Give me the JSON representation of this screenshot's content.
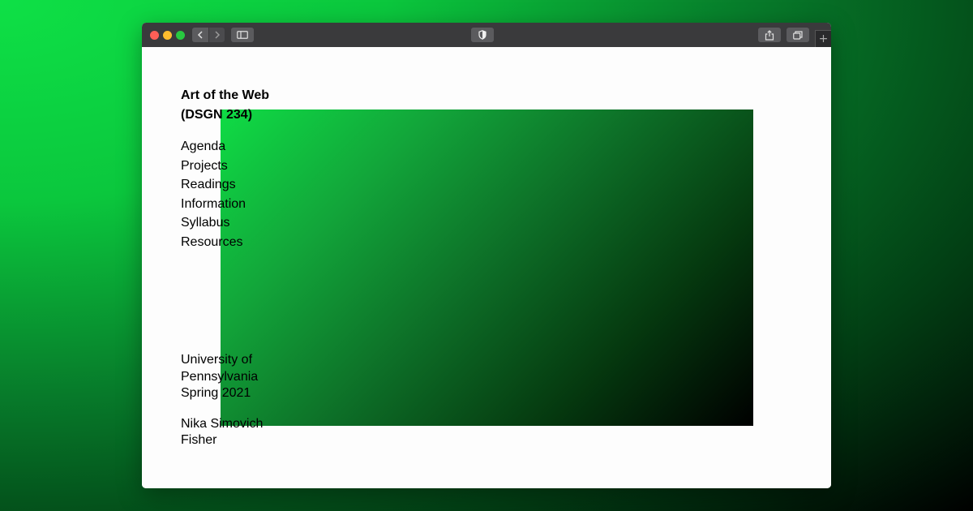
{
  "browser": {
    "buttons": {
      "back_icon": "chevron-left-icon",
      "forward_icon": "chevron-right-icon",
      "sidebar_icon": "sidebar-icon",
      "privacy_icon": "shield-icon",
      "share_icon": "share-icon",
      "tabs_icon": "tabs-overview-icon",
      "new_tab_label": "+"
    }
  },
  "page": {
    "title_line1": "Art of the Web",
    "title_line2": "(DSGN 234)",
    "nav": {
      "agenda": "Agenda",
      "projects": "Projects",
      "readings": "Readings",
      "information": "Information",
      "syllabus": "Syllabus",
      "resources": "Resources"
    },
    "institution_line1": "University of",
    "institution_line2": "Pennsylvania",
    "term": "Spring 2021",
    "author_line1": "Nika Simovich",
    "author_line2": "Fisher"
  },
  "colors": {
    "gradient_start": "#0fdc45",
    "gradient_end": "#000000",
    "page_background": "#fdfdfd"
  }
}
